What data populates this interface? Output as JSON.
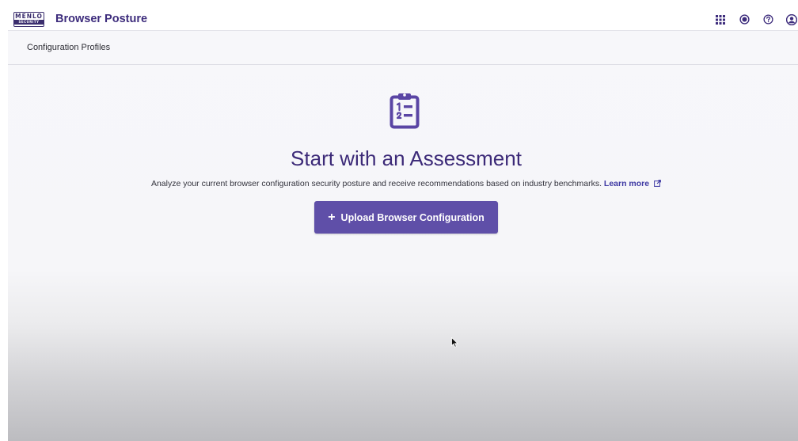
{
  "header": {
    "logo_top": "MENLO",
    "logo_bottom": "SECURITY",
    "title": "Browser Posture",
    "icons": [
      "apps-grid-icon",
      "notification-icon",
      "help-icon",
      "user-account-icon"
    ]
  },
  "breadcrumb": {
    "label": "Configuration Profiles"
  },
  "empty_state": {
    "icon": "clipboard-list-icon",
    "title": "Start with an Assessment",
    "description": "Analyze your current browser configuration security posture and receive recommendations based on industry benchmarks.",
    "learn_more": "Learn more",
    "button_icon": "+",
    "button_label": "Upload Browser Configuration"
  },
  "colors": {
    "brand": "#3d2c7c",
    "button": "#5f4fa8",
    "link": "#3e39a3"
  }
}
